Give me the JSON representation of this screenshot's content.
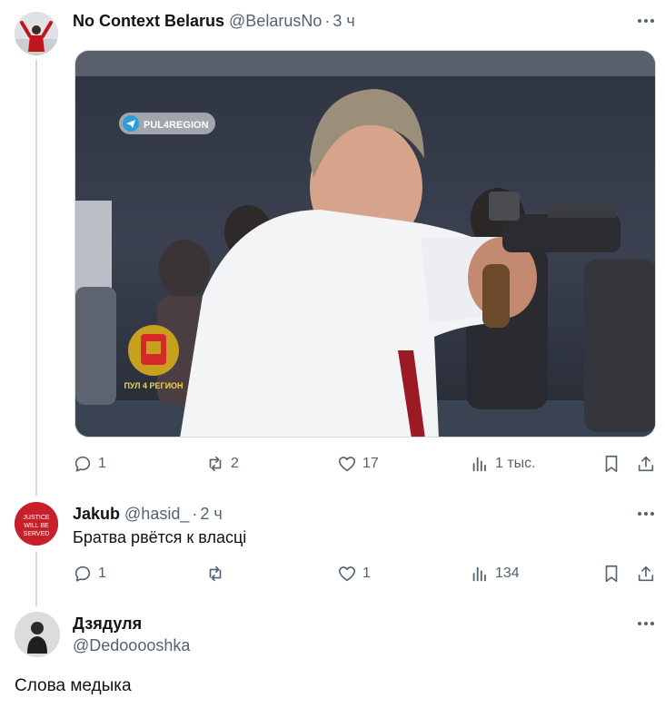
{
  "colors": {
    "text": "#0f1419",
    "secondary": "#536471",
    "line": "#cfd9de"
  },
  "tweet1": {
    "name": "No Context Belarus",
    "handle": "@BelarusNo",
    "separator": "·",
    "time": "3 ч",
    "media": {
      "watermark_channel": "PUL4REGION",
      "emblem_caption": "ПУЛ 4 РЕГИОН"
    },
    "actions": {
      "reply_count": "1",
      "repost_count": "2",
      "like_count": "17",
      "views_count": "1 тыс."
    }
  },
  "reply1": {
    "name": "Jakub",
    "handle": "@hasid_",
    "separator": "·",
    "time": "2 ч",
    "avatar_text": [
      "JUSTICE",
      "WILL BE",
      "SERVED"
    ],
    "text": "Братва рвётся к власці",
    "actions": {
      "reply_count": "1",
      "repost_count": "",
      "like_count": "1",
      "views_count": "134"
    }
  },
  "reply2": {
    "name": "Дзядуля",
    "handle": "@Dedooooshka",
    "text": "Слова медыка"
  }
}
